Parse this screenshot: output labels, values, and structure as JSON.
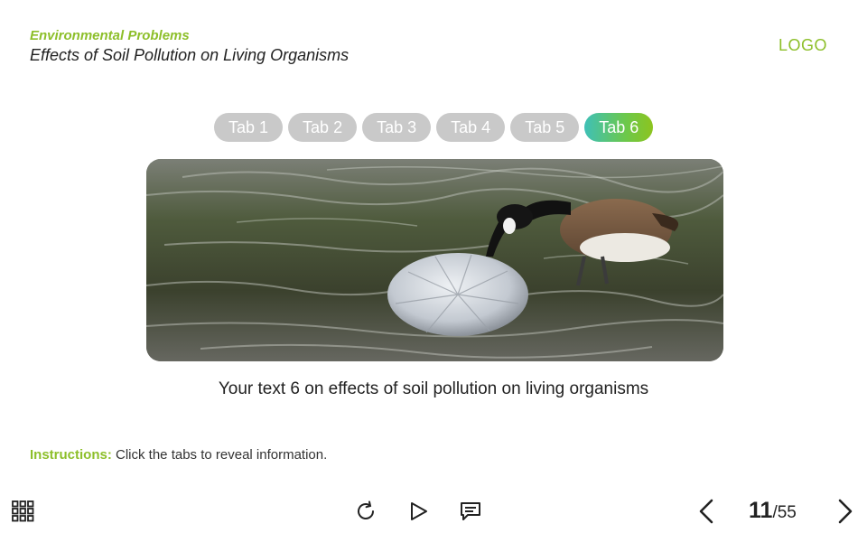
{
  "header": {
    "kicker": "Environmental Problems",
    "title": "Effects of Soil Pollution on Living Organisms",
    "logo": "LOGO"
  },
  "tabs": [
    {
      "label": "Tab 1",
      "active": false
    },
    {
      "label": "Tab 2",
      "active": false
    },
    {
      "label": "Tab 3",
      "active": false
    },
    {
      "label": "Tab 4",
      "active": false
    },
    {
      "label": "Tab 5",
      "active": false
    },
    {
      "label": "Tab 6",
      "active": true
    }
  ],
  "content": {
    "caption": "Your text 6 on effects of soil pollution on living organisms"
  },
  "instructions": {
    "label": "Instructions:",
    "text": " Click the tabs to reveal information."
  },
  "toolbar": {
    "icons": [
      "grid-menu-icon",
      "replay-icon",
      "play-icon",
      "comment-icon",
      "chevron-left-icon",
      "chevron-right-icon"
    ]
  },
  "pager": {
    "current": "11",
    "total": "/55"
  },
  "colors": {
    "accent": "#8dbf2a",
    "tab_inactive": "#c9c9c9",
    "tab_active_start": "#3fc0b7",
    "tab_active_end": "#8dc41f"
  }
}
